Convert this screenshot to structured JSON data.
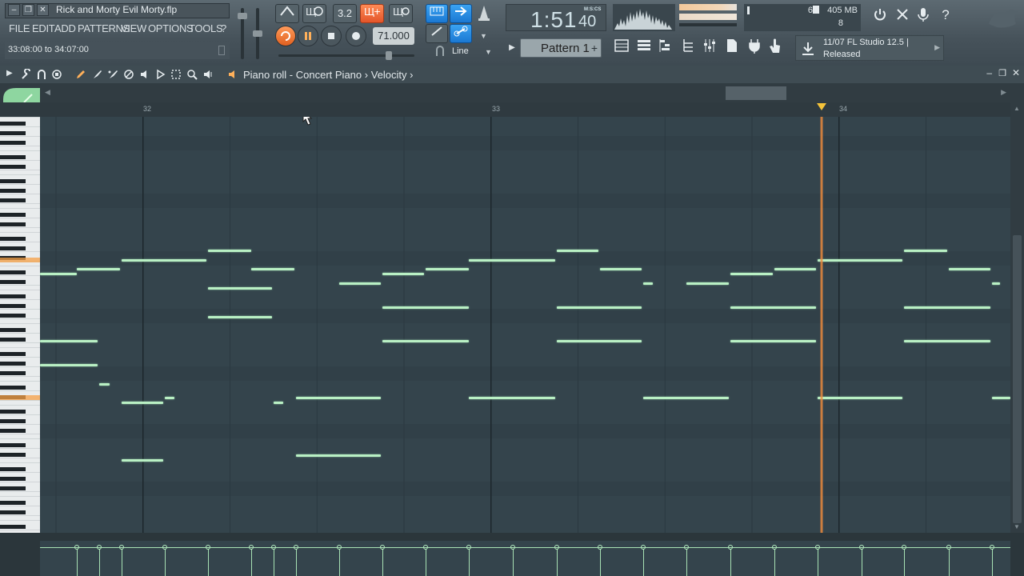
{
  "window": {
    "file_title": "Rick and Morty Evil Morty.flp",
    "buttons": [
      "–",
      "❐",
      "✕"
    ]
  },
  "menu": [
    "FILE",
    "EDIT",
    "ADD",
    "PATTERNS",
    "VIEW",
    "OPTIONS",
    "TOOLS",
    "?"
  ],
  "hint": "33:08:00 to 34:07:00",
  "transport": {
    "tempo": "71.000",
    "time": "1:51",
    "time_sub": "40",
    "time_format": "M:S:CS",
    "pattern": "Pattern 1",
    "snap": "Line",
    "step_label": "3.2"
  },
  "monitor": {
    "cpu": "6",
    "memory": "405 MB",
    "polyphony": "8"
  },
  "news": {
    "title": "11/07  FL Studio 12.5 |",
    "status": "Released"
  },
  "piano_roll": {
    "title": "Piano roll - Concert Piano",
    "sep": "›",
    "target": "Velocity",
    "bars": [
      "32",
      "33",
      "34"
    ],
    "notes": [
      [
        50,
        96,
        342
      ],
      [
        96,
        150,
        336
      ],
      [
        152,
        258,
        325
      ],
      [
        260,
        314,
        313
      ],
      [
        314,
        368,
        336
      ],
      [
        260,
        340,
        360
      ],
      [
        260,
        340,
        396
      ],
      [
        50,
        122,
        426
      ],
      [
        50,
        122,
        456
      ],
      [
        124,
        137,
        480
      ],
      [
        152,
        204,
        503
      ],
      [
        206,
        218,
        497
      ],
      [
        152,
        204,
        575
      ],
      [
        342,
        354,
        503
      ],
      [
        370,
        476,
        497
      ],
      [
        370,
        476,
        569
      ],
      [
        424,
        476,
        354
      ],
      [
        478,
        530,
        342
      ],
      [
        532,
        586,
        336
      ],
      [
        478,
        586,
        384
      ],
      [
        478,
        586,
        426
      ],
      [
        586,
        694,
        325
      ],
      [
        696,
        748,
        313
      ],
      [
        750,
        802,
        336
      ],
      [
        696,
        802,
        384
      ],
      [
        696,
        802,
        426
      ],
      [
        586,
        694,
        497
      ],
      [
        804,
        816,
        354
      ],
      [
        804,
        911,
        497
      ],
      [
        858,
        911,
        354
      ],
      [
        913,
        966,
        342
      ],
      [
        968,
        1020,
        336
      ],
      [
        913,
        1020,
        384
      ],
      [
        913,
        1020,
        426
      ],
      [
        1022,
        1128,
        325
      ],
      [
        1130,
        1184,
        313
      ],
      [
        1186,
        1238,
        336
      ],
      [
        1022,
        1128,
        497
      ],
      [
        1130,
        1238,
        384
      ],
      [
        1130,
        1238,
        426
      ],
      [
        1240,
        1250,
        354
      ],
      [
        1240,
        1263,
        497
      ]
    ],
    "velocity_x": [
      96,
      124,
      152,
      206,
      260,
      314,
      342,
      370,
      424,
      478,
      532,
      586,
      641,
      696,
      750,
      804,
      858,
      913,
      968,
      1022,
      1077,
      1130,
      1186,
      1240
    ]
  },
  "colors": {
    "note": "#b9f0c4",
    "playhead": "#f28c3c",
    "accent_orange": "#e3552a",
    "accent_blue": "#1b78d2"
  }
}
